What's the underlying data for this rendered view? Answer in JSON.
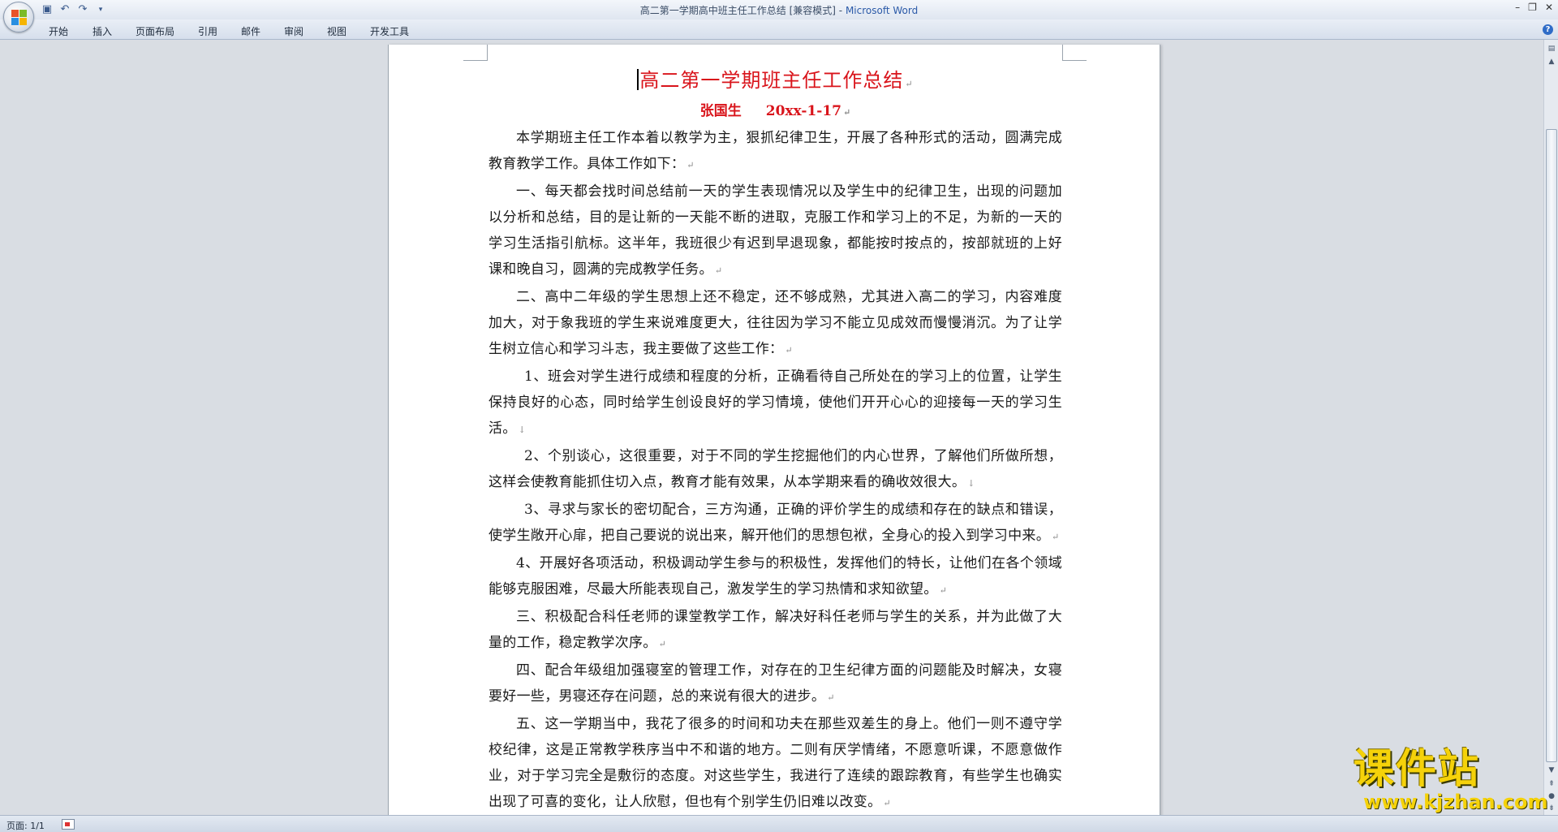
{
  "window": {
    "title": "高二第一学期高中班主任工作总结 [兼容模式]",
    "app_name": "Microsoft Word",
    "title_separator": " - "
  },
  "quick_access": {
    "icons": [
      "save-icon",
      "undo-icon",
      "redo-icon",
      "customize-icon"
    ]
  },
  "ribbon": {
    "tabs": [
      "开始",
      "插入",
      "页面布局",
      "引用",
      "邮件",
      "审阅",
      "视图",
      "开发工具"
    ]
  },
  "document": {
    "title": "高二第一学期班主任工作总结",
    "author": "张国生",
    "date": "20xx-1-17",
    "paragraphs": [
      "本学期班主任工作本着以教学为主，狠抓纪律卫生，开展了各种形式的活动，圆满完成教育教学工作。具体工作如下：",
      "一、每天都会找时间总结前一天的学生表现情况以及学生中的纪律卫生，出现的问题加以分析和总结，目的是让新的一天能不断的进取，克服工作和学习上的不足，为新的一天的学习生活指引航标。这半年，我班很少有迟到早退现象，都能按时按点的，按部就班的上好课和晚自习，圆满的完成教学任务。",
      "二、高中二年级的学生思想上还不稳定，还不够成熟，尤其进入高二的学习，内容难度加大，对于象我班的学生来说难度更大，往往因为学习不能立见成效而慢慢消沉。为了让学生树立信心和学习斗志，我主要做了这些工作：",
      "1、班会对学生进行成绩和程度的分析，正确看待自己所处在的学习上的位置，让学生保持良好的心态，同时给学生创设良好的学习情境，使他们开开心心的迎接每一天的学习生活。",
      "2、个别谈心，这很重要，对于不同的学生挖掘他们的内心世界，了解他们所做所想，这样会使教育能抓住切入点，教育才能有效果，从本学期来看的确收效很大。",
      "3、寻求与家长的密切配合，三方沟通，正确的评价学生的成绩和存在的缺点和错误，使学生敞开心扉，把自己要说的说出来，解开他们的思想包袱，全身心的投入到学习中来。",
      "4、开展好各项活动，积极调动学生参与的积极性，发挥他们的特长，让他们在各个领域能够克服困难，尽最大所能表现自己，激发学生的学习热情和求知欲望。",
      "三、积极配合科任老师的课堂教学工作，解决好科任老师与学生的关系，并为此做了大量的工作，稳定教学次序。",
      "四、配合年级组加强寝室的管理工作，对存在的卫生纪律方面的问题能及时解决，女寝要好一些，男寝还存在问题，总的来说有很大的进步。",
      "五、这一学期当中，我花了很多的时间和功夫在那些双差生的身上。他们一则不遵守学校纪律，这是正常教学秩序当中不和谐的地方。二则有厌学情绪，不愿意听课，不愿意做作业，对于学习完全是敷衍的态度。对这些学生，我进行了连续的跟踪教育，有些学生也确实出现了可喜的变化，让人欣慰，但也有个别学生仍旧难以改变。"
    ]
  },
  "statusbar": {
    "page": "页面: 1/1"
  },
  "watermark": {
    "text": "课件站",
    "url": "www.kjzhan.com"
  },
  "colors": {
    "heading_red": "#d9141b",
    "watermark_yellow": "#f5d20a",
    "app_blue": "#2b5aa8"
  }
}
